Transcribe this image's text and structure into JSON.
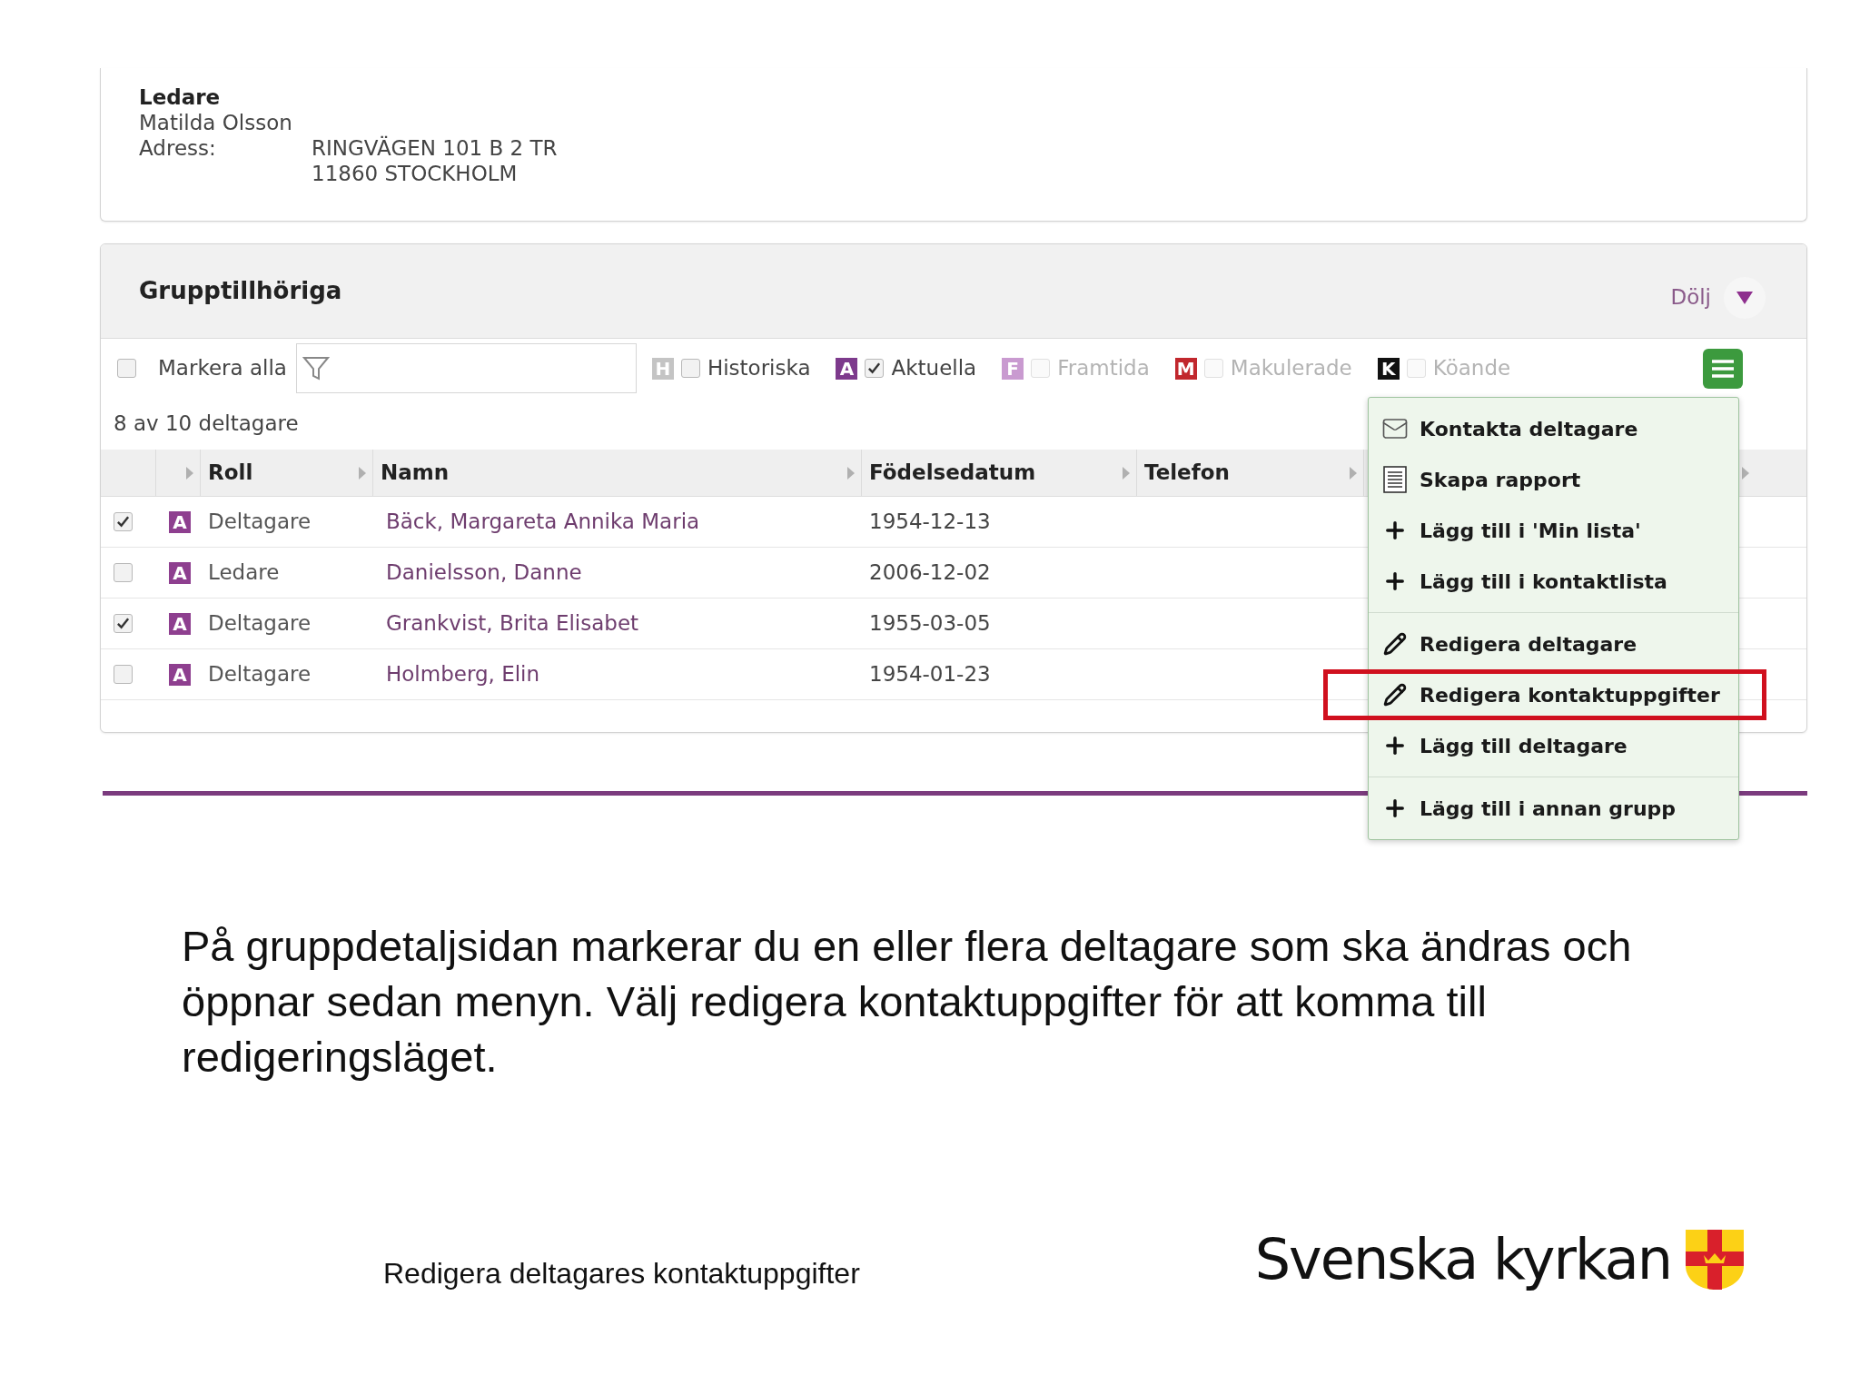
{
  "leader": {
    "title": "Ledare",
    "name": "Matilda Olsson",
    "address_label": "Adress:",
    "address_lines": [
      "RINGVÄGEN 101 B 2 TR",
      "11860 STOCKHOLM"
    ]
  },
  "group": {
    "title": "Grupptillhöriga",
    "toggle": "Dölj",
    "select_all": {
      "label": "Markera alla",
      "checked": false
    },
    "status_filters": [
      {
        "letter": "H",
        "label": "Historiska",
        "color": "#c4c4c4",
        "checked": false,
        "disabled": false
      },
      {
        "letter": "A",
        "label": "Aktuella",
        "color": "#7d3a8c",
        "checked": true,
        "disabled": false
      },
      {
        "letter": "F",
        "label": "Framtida",
        "color": "#c99ad0",
        "checked": false,
        "disabled": true
      },
      {
        "letter": "M",
        "label": "Makulerade",
        "color": "#c1272d",
        "checked": false,
        "disabled": true
      },
      {
        "letter": "K",
        "label": "Köande",
        "color": "#111111",
        "checked": false,
        "disabled": true
      }
    ],
    "count": "8 av 10 deltagare",
    "columns": [
      "Roll",
      "Namn",
      "Födelsedatum",
      "Telefon"
    ],
    "rows": [
      {
        "checked": true,
        "status": "A",
        "color": "#8e3f8f",
        "role": "Deltagare",
        "name": "Bäck, Margareta Annika Maria",
        "birth_date": "1954-12-13"
      },
      {
        "checked": false,
        "status": "A",
        "color": "#8e3f8f",
        "role": "Ledare",
        "name": "Danielsson, Danne",
        "birth_date": "2006-12-02"
      },
      {
        "checked": true,
        "status": "A",
        "color": "#8e3f8f",
        "role": "Deltagare",
        "name": "Grankvist, Brita Elisabet",
        "birth_date": "1955-03-05"
      },
      {
        "checked": false,
        "status": "A",
        "color": "#8e3f8f",
        "role": "Deltagare",
        "name": "Holmberg, Elin",
        "birth_date": "1954-01-23"
      }
    ]
  },
  "menu": {
    "groups": [
      [
        {
          "kind": "mail",
          "label": "Kontakta deltagare",
          "highlighted": false
        },
        {
          "kind": "report",
          "label": "Skapa rapport",
          "highlighted": false
        },
        {
          "kind": "plus",
          "label": "Lägg till i 'Min lista'",
          "highlighted": false
        },
        {
          "kind": "plus",
          "label": "Lägg till i kontaktlista",
          "highlighted": false
        }
      ],
      [
        {
          "kind": "pencil",
          "label": "Redigera deltagare",
          "highlighted": false
        },
        {
          "kind": "pencil",
          "label": "Redigera kontaktuppgifter",
          "highlighted": true
        },
        {
          "kind": "plus",
          "label": "Lägg till deltagare",
          "highlighted": false
        }
      ],
      [
        {
          "kind": "plus",
          "label": "Lägg till i annan grupp",
          "highlighted": false
        }
      ]
    ]
  },
  "caption": "På gruppdetaljsidan markerar du en eller flera deltagare som ska ändras och öppnar sedan menyn. Välj redigera kontaktuppgifter för att komma till redigeringsläget.",
  "footer": "Redigera deltagares kontaktuppgifter",
  "logo": "Svenska kyrkan"
}
